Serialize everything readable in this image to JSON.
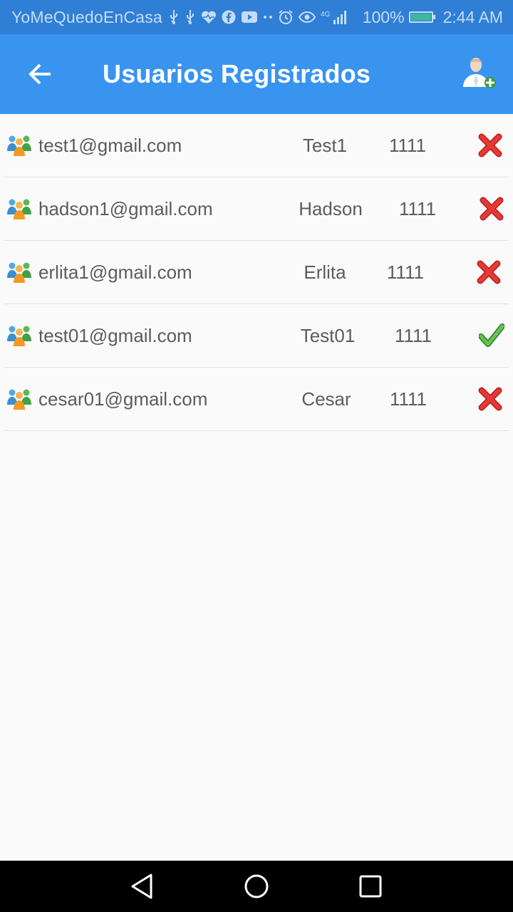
{
  "status_bar": {
    "carrier": "YoMeQuedoEnCasa",
    "network": "4G",
    "battery": "100%",
    "time": "2:44 AM"
  },
  "app_bar": {
    "title": "Usuarios Registrados",
    "back_icon": "arrow-back-icon",
    "action_icon": "add-user-icon"
  },
  "users": [
    {
      "email": "test1@gmail.com",
      "name": "Test1",
      "code": "1111",
      "status": "inactive"
    },
    {
      "email": "hadson1@gmail.com",
      "name": "Hadson",
      "code": "1111",
      "status": "inactive"
    },
    {
      "email": "erlita1@gmail.com",
      "name": "Erlita",
      "code": "1111",
      "status": "inactive"
    },
    {
      "email": "test01@gmail.com",
      "name": "Test01",
      "code": "1111",
      "status": "active"
    },
    {
      "email": "cesar01@gmail.com",
      "name": "Cesar",
      "code": "1111",
      "status": "inactive"
    }
  ],
  "colors": {
    "status_bar": "#2f7fd6",
    "app_bar": "#3994f0",
    "inactive": "#e53935",
    "active": "#43a832"
  },
  "nav_bar": {
    "back": "nav-back-icon",
    "home": "nav-home-icon",
    "recents": "nav-recents-icon"
  }
}
